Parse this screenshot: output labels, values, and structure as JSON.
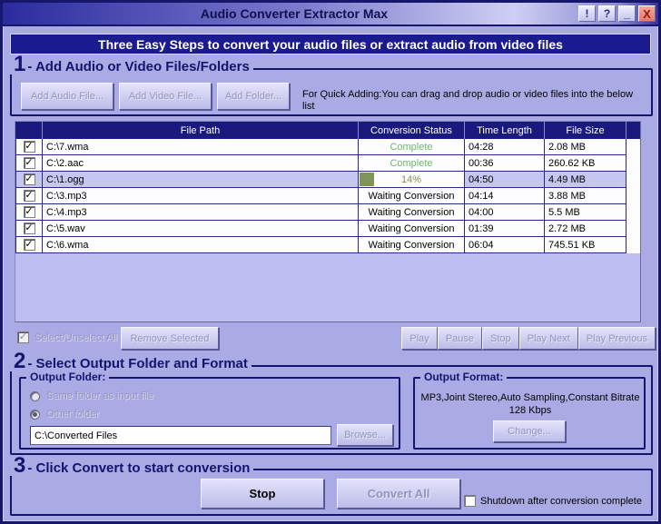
{
  "window": {
    "title": "Audio Converter Extractor Max",
    "controls": {
      "info": "!",
      "help": "?",
      "minimize": "_",
      "close": "X"
    }
  },
  "banner": "Three Easy Steps to convert your audio files or extract audio from video files",
  "colors": {
    "background": "#aaaae4",
    "header": "#1a1a7e",
    "accent_navy": "#14146e",
    "complete_green": "#6cb86c",
    "progress_olive": "#7f935a",
    "close_button": "#e87868"
  },
  "step1": {
    "number": "1",
    "title": "- Add Audio or Video Files/Folders",
    "buttons": [
      "Add Audio File...",
      "Add Video File...",
      "Add Folder..."
    ],
    "hint": "For Quick Adding:You can drag and drop audio or video files into the below list"
  },
  "file_table": {
    "headers": [
      "File Path",
      "Conversion Status",
      "Time Length",
      "File Size"
    ],
    "rows": [
      {
        "checked": true,
        "path": "C:\\7.wma",
        "status": "Complete",
        "status_type": "complete",
        "time": "04:28",
        "size": "2.08 MB"
      },
      {
        "checked": true,
        "path": "C:\\2.aac",
        "status": "Complete",
        "status_type": "complete",
        "time": "00:36",
        "size": "260.62 KB"
      },
      {
        "checked": true,
        "path": "C:\\1.ogg",
        "status": "14%",
        "status_type": "progress",
        "progress_percent": 14,
        "progress_style": "width:14%",
        "selected": true,
        "time": "04:50",
        "size": "4.49 MB"
      },
      {
        "checked": true,
        "path": "C:\\3.mp3",
        "status": "Waiting Conversion",
        "status_type": "waiting",
        "time": "04:14",
        "size": "3.88 MB"
      },
      {
        "checked": true,
        "path": "C:\\4.mp3",
        "status": "Waiting Conversion",
        "status_type": "waiting",
        "time": "04:00",
        "size": "5.5 MB"
      },
      {
        "checked": true,
        "path": "C:\\5.wav",
        "status": "Waiting Conversion",
        "status_type": "waiting",
        "time": "01:39",
        "size": "2.72 MB"
      },
      {
        "checked": true,
        "path": "C:\\6.wma",
        "status": "Waiting Conversion",
        "status_type": "waiting",
        "time": "06:04",
        "size": "745.51 KB"
      }
    ]
  },
  "list_controls": {
    "select_all_label": "Select/Unselect All",
    "select_all_checked": true,
    "remove_label": "Remove Selected",
    "playback": [
      "Play",
      "Pause",
      "Stop",
      "Play Next",
      "Play Previous"
    ]
  },
  "step2": {
    "number": "2",
    "title": "- Select Output Folder and Format",
    "output_folder": {
      "label": "Output Folder:",
      "radio_same": "Same folder as input file",
      "radio_other": "Other folder",
      "selected": "other",
      "path_value": "C:\\Converted Files",
      "browse_label": "Browse..."
    },
    "output_format": {
      "label": "Output Format:",
      "description": "MP3,Joint Stereo,Auto Sampling,Constant Bitrate 128 Kbps",
      "change_label": "Change..."
    }
  },
  "step3": {
    "number": "3",
    "title": "- Click Convert to start conversion",
    "stop_label": "Stop",
    "convert_label": "Convert All",
    "shutdown_label": "Shutdown after conversion complete",
    "shutdown_checked": false
  }
}
